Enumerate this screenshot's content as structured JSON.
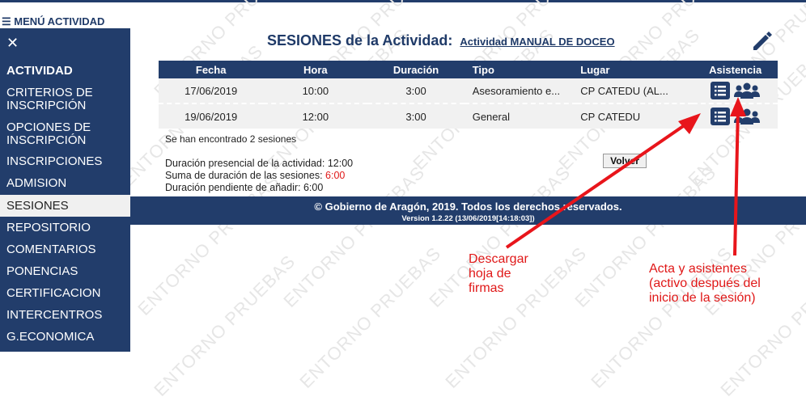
{
  "watermark": "ENTORNO PRUEBAS",
  "menu": {
    "header": "☰ MENÚ ACTIVIDAD",
    "close_glyph": "✕"
  },
  "sidebar": {
    "items": [
      {
        "label": "ACTIVIDAD"
      },
      {
        "label": "CRITERIOS DE"
      },
      {
        "label": "INSCRIPCIÓN"
      },
      {
        "label": "OPCIONES DE"
      },
      {
        "label": "INSCRIPCIÓN"
      },
      {
        "label": "INSCRIPCIONES"
      },
      {
        "label": "ADMISION"
      },
      {
        "label": "SESIONES"
      },
      {
        "label": "REPOSITORIO"
      },
      {
        "label": "COMENTARIOS"
      },
      {
        "label": "PONENCIAS"
      },
      {
        "label": "CERTIFICACION"
      },
      {
        "label": "INTERCENTROS"
      },
      {
        "label": "G.ECONOMICA"
      }
    ],
    "active_item": "SESIONES"
  },
  "page": {
    "title": "SESIONES de la Actividad:",
    "activity_link": "Actividad MANUAL DE DOCEO",
    "edit_icon": "pencil-icon"
  },
  "table": {
    "headers": {
      "fecha": "Fecha",
      "hora": "Hora",
      "duracion": "Duración",
      "tipo": "Tipo",
      "lugar": "Lugar",
      "asistencia": "Asistencia"
    },
    "rows": [
      {
        "fecha": "17/06/2019",
        "hora": "10:00",
        "duracion": "3:00",
        "tipo": "Asesoramiento e...",
        "lugar": "CP CATEDU (AL..."
      },
      {
        "fecha": "19/06/2019",
        "hora": "12:00",
        "duracion": "3:00",
        "tipo": "General",
        "lugar": "CP CATEDU"
      }
    ]
  },
  "summary": {
    "found": "Se han encontrado 2 sesiones",
    "presencial_label": "Duración presencial de la actividad:",
    "presencial_value": "12:00",
    "suma_label": "Suma de duración de las sesiones:",
    "suma_value": "6:00",
    "pendiente_label": "Duración pendiente de añadir:",
    "pendiente_value": "6:00"
  },
  "buttons": {
    "volver": "Volver"
  },
  "footer": {
    "copyright": "© Gobierno de Aragón, 2019. Todos los derechos reservados.",
    "version": "Version 1.2.22 (13/06/2019[14:18:03])"
  },
  "annotations": {
    "left": [
      "Descargar",
      "hoja de",
      "firmas"
    ],
    "right": [
      "Acta y asistentes",
      "(activo después del",
      "inicio de la sesión)"
    ]
  },
  "colors": {
    "navy": "#223d6b",
    "red": "#e01818",
    "row_bg": "#f1f1f1"
  }
}
